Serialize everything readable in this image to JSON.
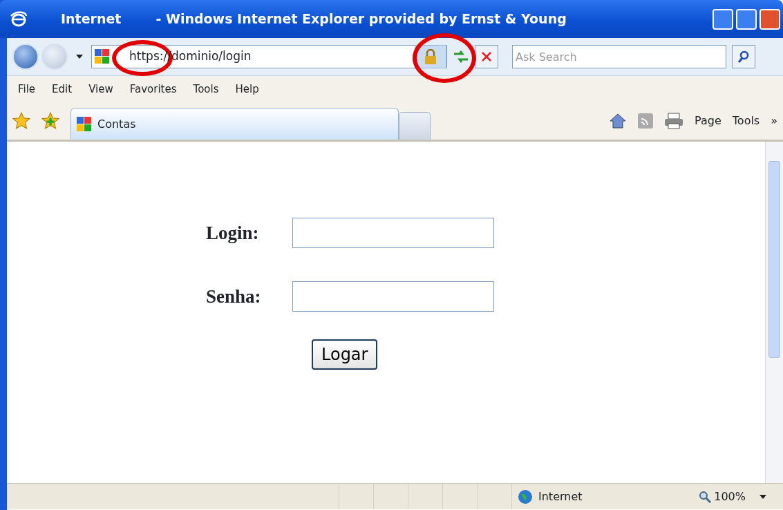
{
  "window": {
    "title_parts": [
      "Internet",
      "- Windows Internet Explorer provided by Ernst & Young"
    ]
  },
  "address_bar": {
    "url": "https://dominio/login"
  },
  "search": {
    "placeholder": "Ask Search"
  },
  "menu": [
    "File",
    "Edit",
    "View",
    "Favorites",
    "Tools",
    "Help"
  ],
  "tabs": [
    {
      "label": "Contas",
      "selected": true
    }
  ],
  "command_bar": {
    "page": "Page",
    "tools": "Tools",
    "more": "»"
  },
  "form": {
    "fields": [
      {
        "label": "Login:"
      },
      {
        "label": "Senha:"
      }
    ],
    "submit": "Logar"
  },
  "status_bar": {
    "zone": "Internet",
    "zoom": "100%"
  }
}
